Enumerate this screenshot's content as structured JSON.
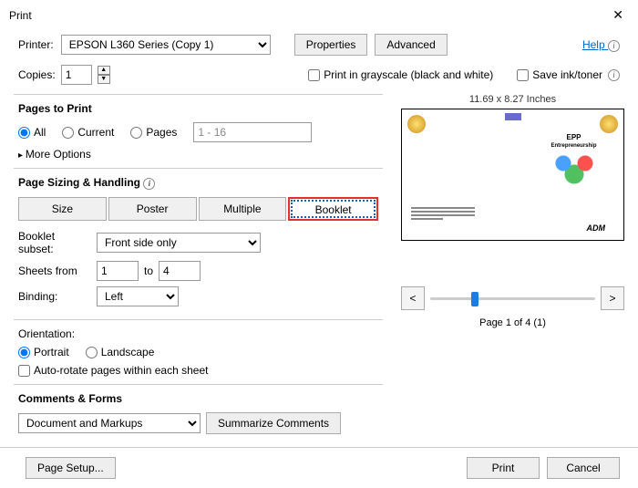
{
  "window": {
    "title": "Print"
  },
  "top": {
    "printer_label": "Printer:",
    "printer_value": "EPSON L360 Series (Copy 1)",
    "properties_btn": "Properties",
    "advanced_btn": "Advanced",
    "help_link": "Help",
    "copies_label": "Copies:",
    "copies_value": "1",
    "grayscale_label": "Print in grayscale (black and white)",
    "saveink_label": "Save ink/toner"
  },
  "pages": {
    "title": "Pages to Print",
    "all": "All",
    "current": "Current",
    "pages": "Pages",
    "range_value": "1 - 16",
    "more_options": "More Options"
  },
  "sizing": {
    "title": "Page Sizing & Handling",
    "size": "Size",
    "poster": "Poster",
    "multiple": "Multiple",
    "booklet": "Booklet",
    "subset_label": "Booklet subset:",
    "subset_value": "Front side only",
    "sheets_from_label": "Sheets from",
    "sheets_from_value": "1",
    "to_label": "to",
    "sheets_to_value": "4",
    "binding_label": "Binding:",
    "binding_value": "Left"
  },
  "orientation": {
    "title": "Orientation:",
    "portrait": "Portrait",
    "landscape": "Landscape",
    "auto_rotate": "Auto-rotate pages within each sheet"
  },
  "comments": {
    "title": "Comments & Forms",
    "select_value": "Document and Markups",
    "summarize_btn": "Summarize Comments"
  },
  "preview": {
    "dimensions": "11.69 x 8.27 Inches",
    "doc_title": "EPP",
    "doc_sub": "Entrepreneurship",
    "adm": "ADM",
    "page_info": "Page 1 of 4 (1)"
  },
  "footer": {
    "page_setup": "Page Setup...",
    "print": "Print",
    "cancel": "Cancel"
  }
}
